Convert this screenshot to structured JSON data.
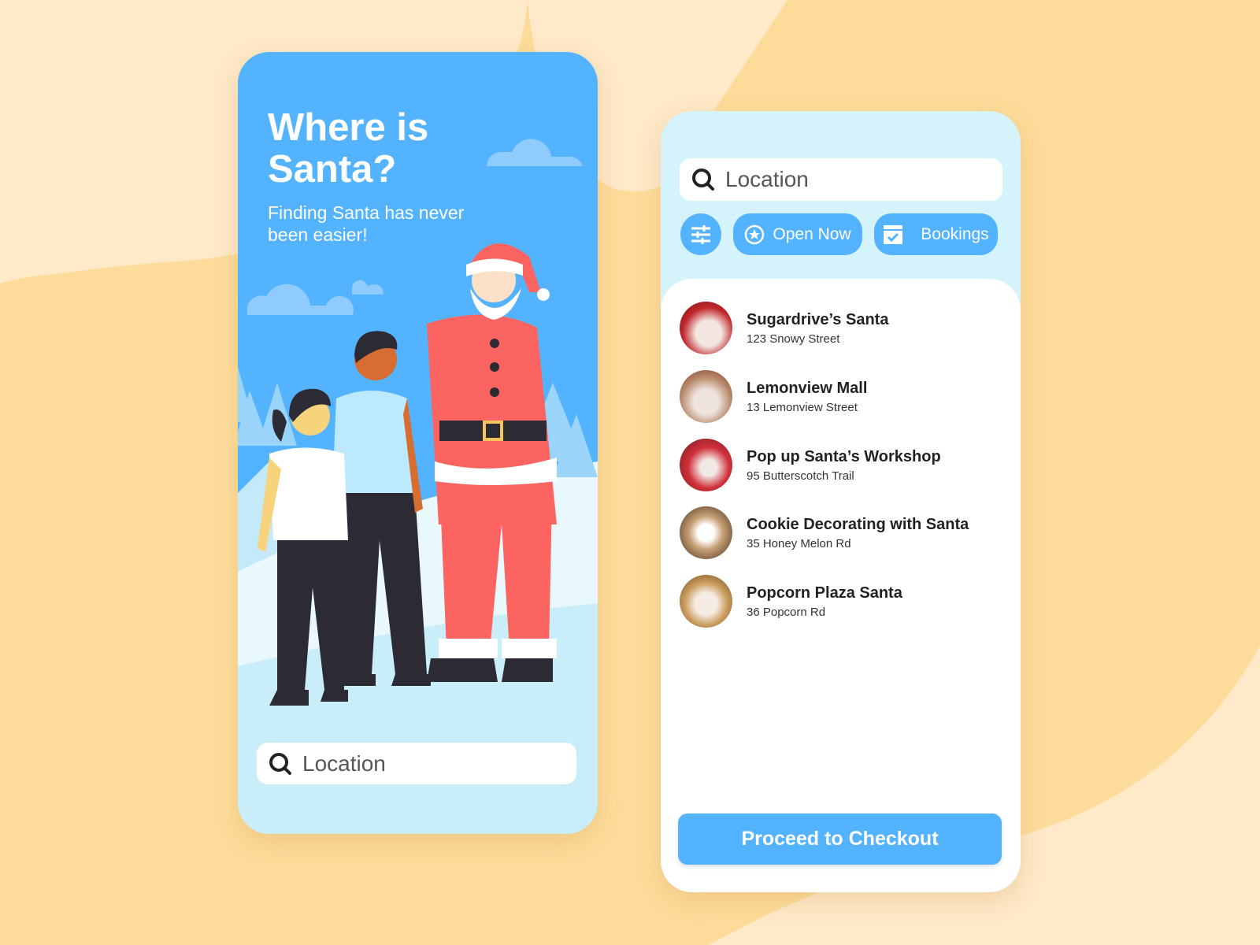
{
  "welcome": {
    "title_line1": "Where is",
    "title_line2": "Santa?",
    "subtitle": "Finding Santa has never been easier!",
    "search_placeholder": "Location"
  },
  "results": {
    "search_placeholder": "Location",
    "filters": {
      "open_now": "Open Now",
      "bookings": "Bookings"
    },
    "items": [
      {
        "name": "Sugardrive’s Santa",
        "address": "123 Snowy Street"
      },
      {
        "name": "Lemonview Mall",
        "address": "13 Lemonview Street"
      },
      {
        "name": "Pop up Santa’s Workshop",
        "address": "95 Butterscotch Trail"
      },
      {
        "name": "Cookie Decorating with Santa",
        "address": "35 Honey Melon Rd"
      },
      {
        "name": "Popcorn Plaza Santa",
        "address": "36 Popcorn Rd"
      }
    ],
    "checkout_label": "Proceed to Checkout"
  },
  "colors": {
    "accent": "#53b3fe",
    "background": "#fddc9b",
    "panel": "#d5f3fa"
  }
}
